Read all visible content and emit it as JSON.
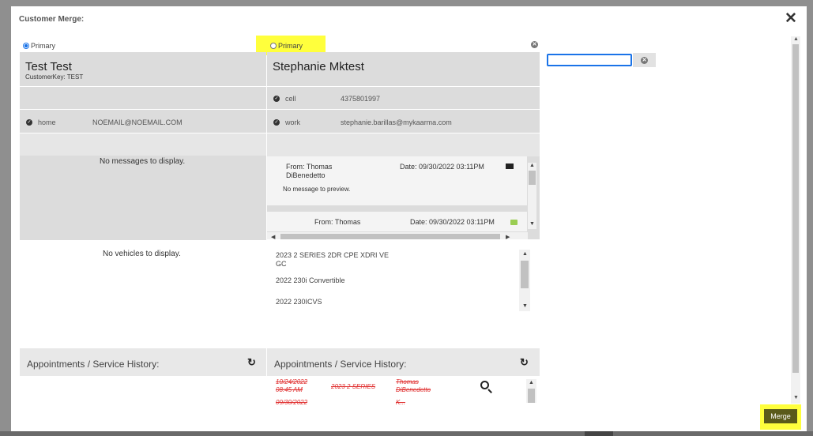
{
  "modal": {
    "title": "Customer Merge:",
    "close_icon": "close-icon"
  },
  "left": {
    "primary_label": "Primary",
    "primary_selected": true,
    "name": "Test Test",
    "customer_key": "CustomerKey: TEST",
    "contacts": [
      {
        "type": "home",
        "value": "NOEMAIL@NOEMAIL.COM"
      }
    ],
    "messages_empty": "No messages to display.",
    "vehicles_empty": "No vehicles to display.",
    "appointments_title": "Appointments / Service History:"
  },
  "right": {
    "primary_label": "Primary",
    "primary_selected": false,
    "name": "Stephanie Mktest",
    "contacts": [
      {
        "type": "cell",
        "value": "4375801997"
      },
      {
        "type": "work",
        "value": "stephanie.barillas@mykaarma.com"
      }
    ],
    "messages": [
      {
        "from": "From: Thomas DiBenedetto",
        "date": "Date: 09/30/2022 03:11PM",
        "preview": "No message to preview.",
        "icon": "envelope-icon"
      },
      {
        "from": "From: Thomas",
        "date": "Date: 09/30/2022 03:11PM",
        "icon": "chat-icon"
      }
    ],
    "vehicles": [
      "2023 2 SERIES 2DR CPE XDRI VE GC",
      "2022 230i Convertible",
      "2022 230ICVS"
    ],
    "appointments_title": "Appointments / Service History:",
    "appointments": [
      {
        "date": "10/24/2022 08:45 AM",
        "vehicle": "2023 2 SERIES",
        "advisor": "Thomas DiBenedetto"
      },
      {
        "date": "09/30/2022",
        "vehicle": "",
        "advisor": "K..."
      }
    ]
  },
  "merge_label": "Merge",
  "colors": {
    "highlight": "#ffff3c",
    "radio_selected": "#1a73e8",
    "strike": "#e03030"
  }
}
